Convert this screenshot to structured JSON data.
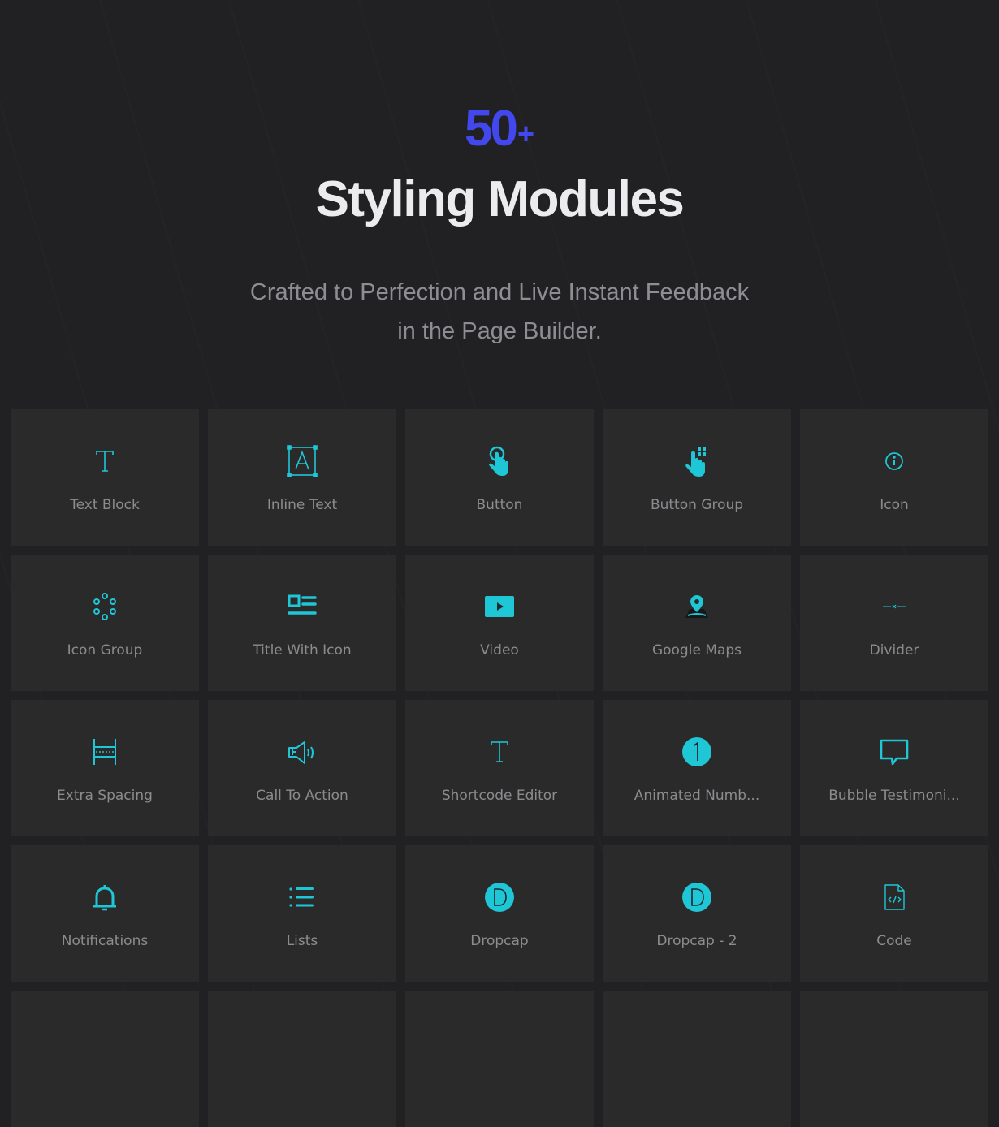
{
  "hero": {
    "count": "50",
    "count_suffix": "+",
    "title": "Styling Modules",
    "subtitle_line1": "Crafted to Perfection and Live Instant Feedback",
    "subtitle_line2": "in the Page Builder."
  },
  "colors": {
    "background": "#212123",
    "card": "#2a2a2b",
    "accent_cyan": "#1ec6d6",
    "count_blue": "#4248ee",
    "title": "#ececef",
    "subtitle": "#8e8e92",
    "label": "#8c8c8f"
  },
  "modules": [
    {
      "label": "Text Block",
      "icon": "text-t-icon"
    },
    {
      "label": "Inline Text",
      "icon": "inline-text-icon"
    },
    {
      "label": "Button",
      "icon": "tap-finger-icon"
    },
    {
      "label": "Button Group",
      "icon": "tap-grid-icon"
    },
    {
      "label": "Icon",
      "icon": "info-circle-icon"
    },
    {
      "label": "Icon Group",
      "icon": "dots-circle-icon"
    },
    {
      "label": "Title With Icon",
      "icon": "title-with-icon-icon"
    },
    {
      "label": "Video",
      "icon": "video-play-icon"
    },
    {
      "label": "Google Maps",
      "icon": "map-pin-icon"
    },
    {
      "label": "Divider",
      "icon": "divider-icon"
    },
    {
      "label": "Extra Spacing",
      "icon": "spacing-icon"
    },
    {
      "label": "Call To Action",
      "icon": "megaphone-icon"
    },
    {
      "label": "Shortcode Editor",
      "icon": "text-t-icon"
    },
    {
      "label": "Animated Numb...",
      "icon": "number-one-icon"
    },
    {
      "label": "Bubble Testimoni...",
      "icon": "speech-bubble-icon"
    },
    {
      "label": "Notifications",
      "icon": "bell-icon"
    },
    {
      "label": "Lists",
      "icon": "list-icon"
    },
    {
      "label": "Dropcap",
      "icon": "dropcap-icon"
    },
    {
      "label": "Dropcap - 2",
      "icon": "dropcap-icon"
    },
    {
      "label": "Code",
      "icon": "code-file-icon"
    }
  ]
}
